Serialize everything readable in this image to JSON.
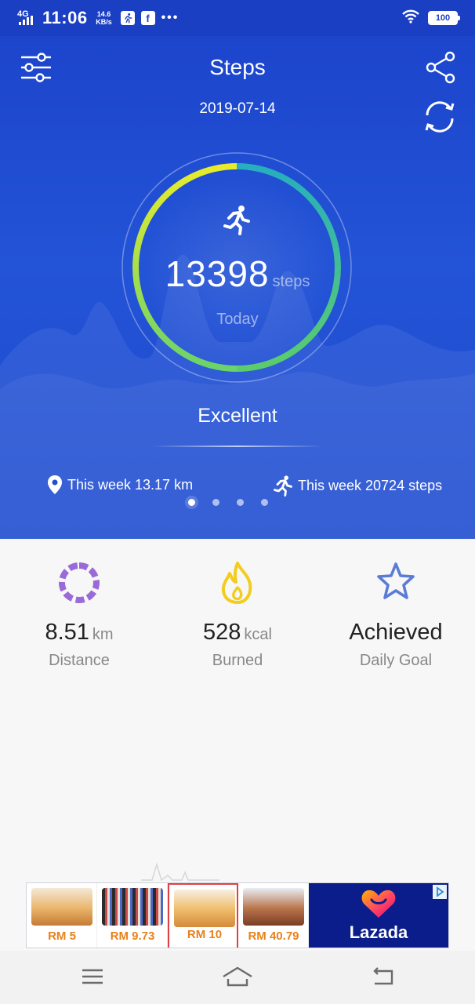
{
  "status_bar": {
    "network": "4G",
    "time": "11:06",
    "speed_value": "14.6",
    "speed_unit": "KB/s",
    "overflow": "•••",
    "battery": "100",
    "icons": [
      "run-app-icon",
      "facebook-icon",
      "wifi-icon",
      "battery-icon"
    ]
  },
  "header": {
    "title": "Steps",
    "date": "2019-07-14",
    "icons": [
      "filter-sliders-icon",
      "share-icon",
      "sync-icon"
    ]
  },
  "summary": {
    "steps": "13398",
    "steps_unit": "steps",
    "period": "Today",
    "rating": "Excellent",
    "ring_progress": 1.0
  },
  "weekly": {
    "distance": "This week 13.17 km",
    "steps": "This week 20724 steps"
  },
  "pager": {
    "count": 4,
    "active": 0
  },
  "stats": [
    {
      "value": "8.51",
      "unit": "km",
      "label": "Distance",
      "icon": "distance-ring-icon",
      "color": "#9a6ad8"
    },
    {
      "value": "528",
      "unit": "kcal",
      "label": "Burned",
      "icon": "flame-icon",
      "color": "#f2cc1f"
    },
    {
      "value": "Achieved",
      "unit": "",
      "label": "Daily Goal",
      "icon": "star-icon",
      "color": "#5b7bd6"
    }
  ],
  "ad": {
    "prices": [
      "RM 5",
      "RM 9.73",
      "RM 10",
      "RM 40.79"
    ],
    "brand": "Lazada",
    "accent": "#e8811a"
  },
  "nav": {
    "icons": [
      "menu-icon",
      "home-icon",
      "back-icon"
    ]
  },
  "colors": {
    "hero_blue": "#1f4acf",
    "ring_green": "#5ecf6a",
    "ring_yellow": "#e2ea2c",
    "ring_teal": "#2cb3b9"
  }
}
